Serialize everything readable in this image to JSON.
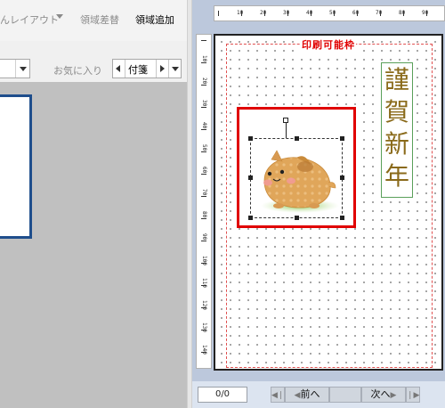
{
  "toolbar": {
    "layout_menu_label": "んレイアウト",
    "area_replace_label": "領域差替",
    "area_add_label": "領域追加"
  },
  "row2": {
    "favorites_label": "お気に入り",
    "tag_value": "付箋"
  },
  "paper": {
    "print_area_label": "印刷可能枠",
    "greeting_chars": [
      "謹",
      "賀",
      "新",
      "年"
    ]
  },
  "rulers": {
    "horizontal_labels": [
      "10",
      "20",
      "30",
      "40",
      "50",
      "60",
      "70",
      "80",
      "90"
    ],
    "vertical_labels": [
      "10",
      "20",
      "30",
      "40",
      "50",
      "60",
      "70",
      "80",
      "90",
      "100",
      "110",
      "120",
      "130",
      "140"
    ]
  },
  "status": {
    "page_indicator": "0/0",
    "prev_label": "前へ",
    "next_label": "次へ"
  },
  "colors": {
    "accent_blue": "#1f4e8c",
    "print_frame_red": "#e00000",
    "greeting_gold": "#8a6a1a",
    "canvas_bg": "#bcc8dc",
    "workspace_gray": "#c0c0c0"
  }
}
